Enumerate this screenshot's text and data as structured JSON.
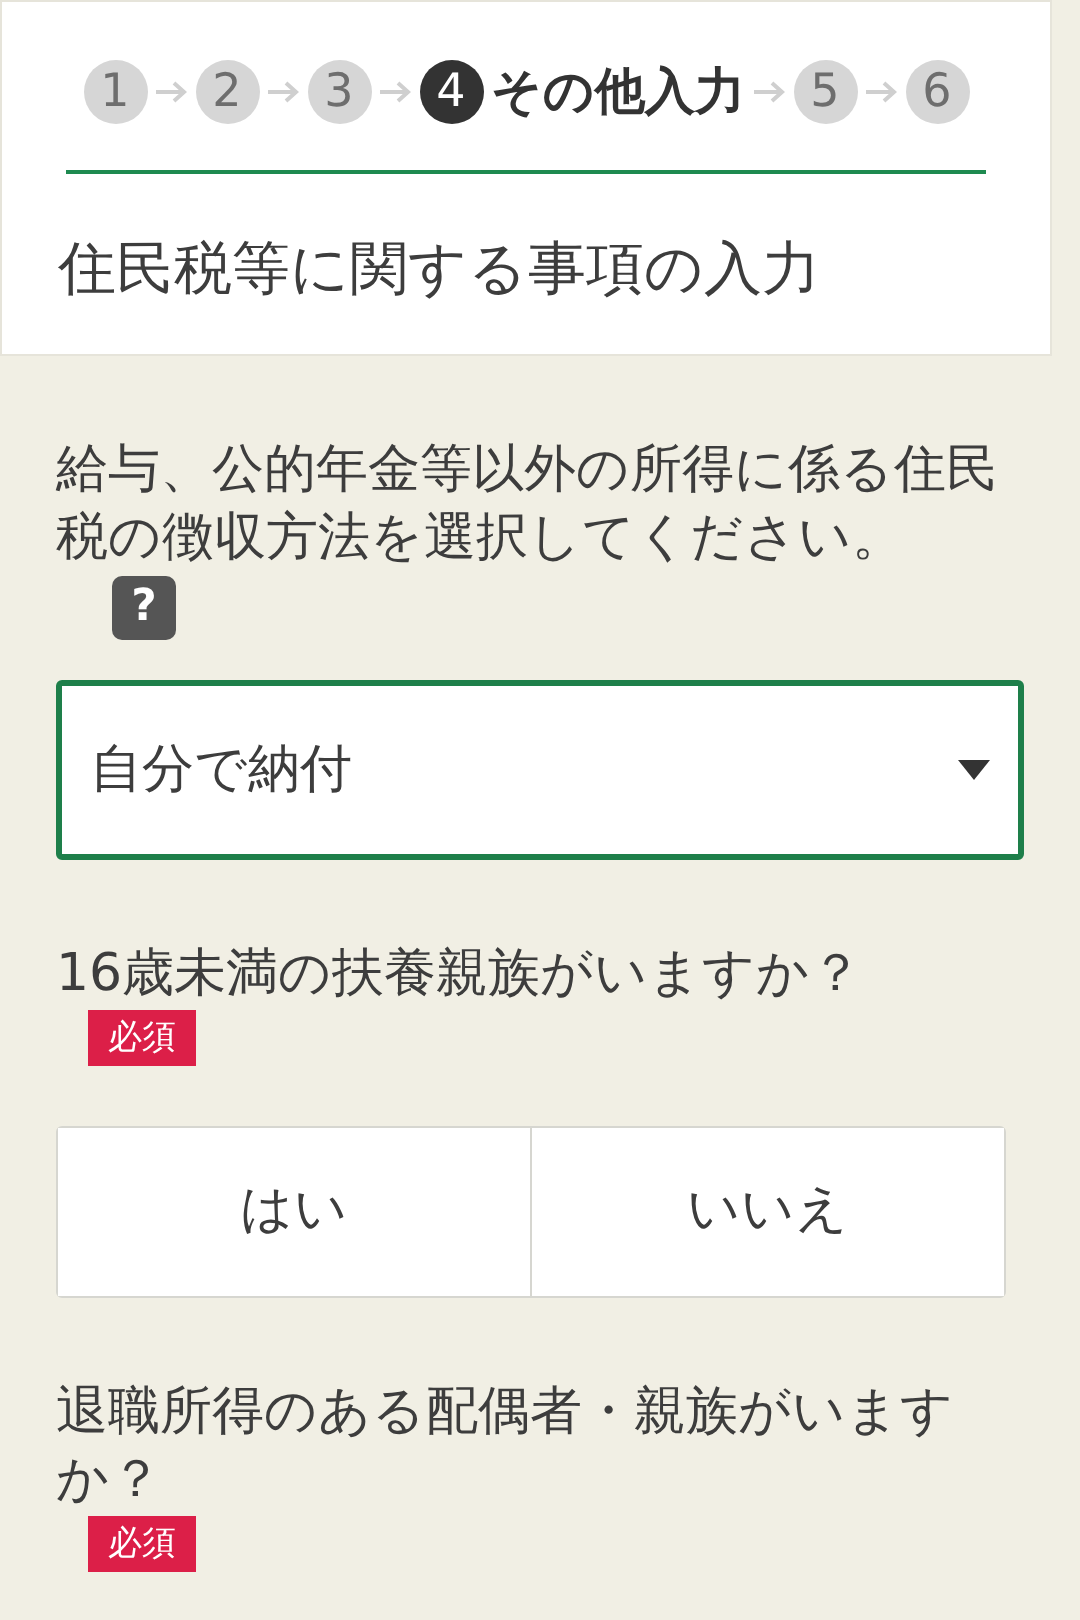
{
  "steps": [
    {
      "number": "1",
      "selected": false
    },
    {
      "number": "2",
      "selected": false
    },
    {
      "number": "3",
      "selected": false
    },
    {
      "number": "4",
      "label": "その他入力",
      "selected": true
    },
    {
      "number": "5",
      "selected": false
    },
    {
      "number": "6",
      "selected": false
    }
  ],
  "title": "住民税等に関する事項の入力",
  "questions": [
    {
      "kind": "select",
      "text": "給与、公的年金等以外の所得に係る住民税の徴収方法を選択してください。",
      "help": "?",
      "value": "自分で納付"
    },
    {
      "kind": "choice",
      "text": "16歳未満の扶養親族がいますか？",
      "badge": "必須",
      "options": [
        {
          "label": "はい",
          "selected": false
        },
        {
          "label": "いいえ",
          "selected": false
        }
      ]
    },
    {
      "kind": "choice_cut",
      "text": "退職所得のある配偶者・親族がいますか？",
      "badge": "必須"
    }
  ]
}
